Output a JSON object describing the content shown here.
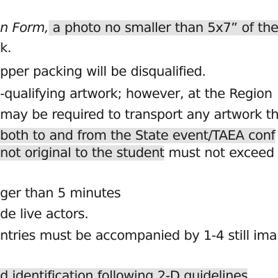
{
  "document": {
    "lines": [
      {
        "italic": "n Form,",
        "highlight": " a photo no smaller than 5x7” of the"
      },
      {
        "text": "k."
      },
      {
        "text": "pper packing will be disqualified."
      },
      {
        "text": "-qualifying artwork; however, at the Region"
      },
      {
        "text": "may be required to transport any artwork th"
      },
      {
        "highlight": "both to and from the State event/TAEA conf"
      },
      {
        "highlight": "not original to the student",
        "text": " must not exceed"
      },
      {
        "text": "ger than 5 minutes"
      },
      {
        "text": "de live actors."
      },
      {
        "text": "ntries must be accompanied by 1-4 still ima"
      },
      {
        "highlight": "d identification following 2-D guidelines"
      }
    ]
  }
}
